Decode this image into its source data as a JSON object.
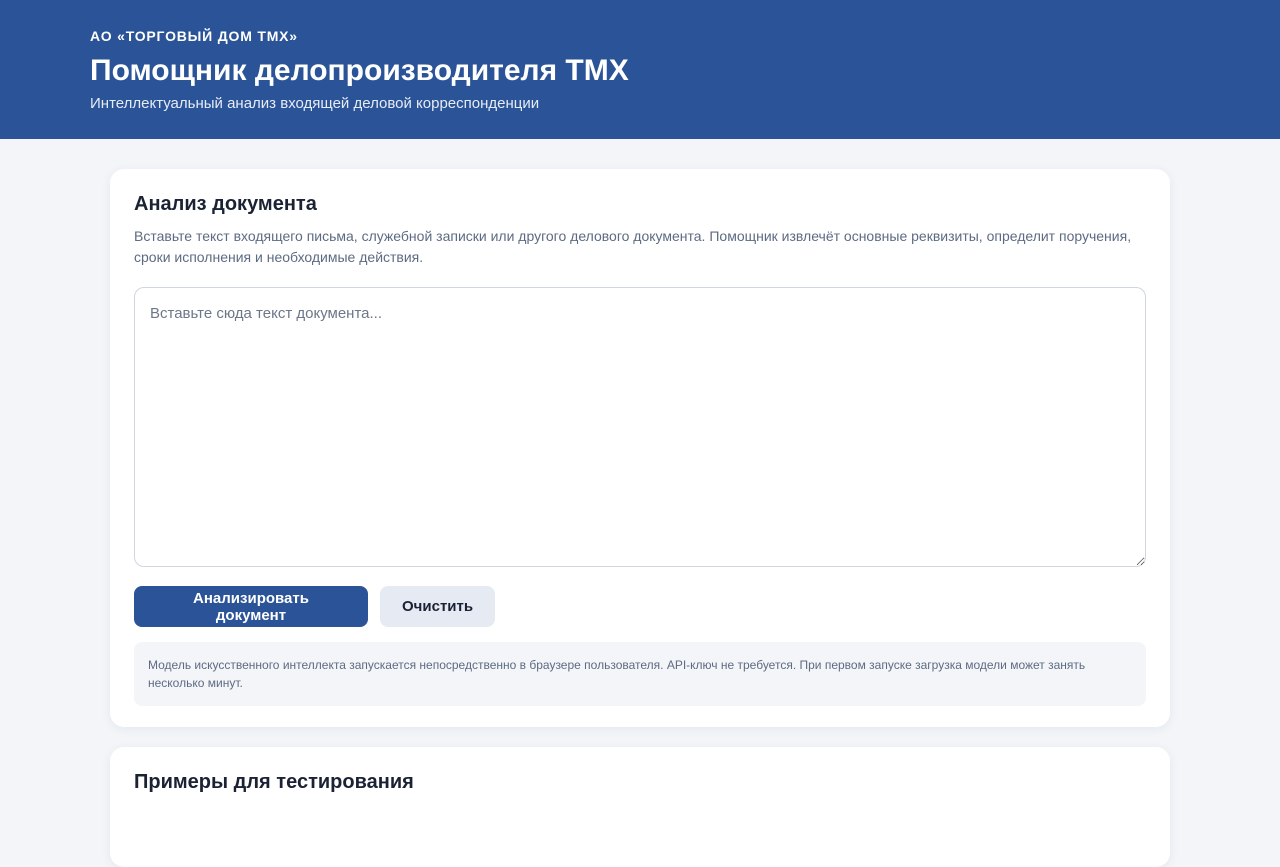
{
  "header": {
    "org": "АО «ТОРГОВЫЙ ДОМ ТМХ»",
    "title": "Помощник делопроизводителя ТМХ",
    "subtitle": "Интеллектуальный анализ входящей деловой корреспонденции"
  },
  "analyze": {
    "title": "Анализ документа",
    "description": "Вставьте текст входящего письма, служебной записки или другого делового документа. Помощник извлечёт основные реквизиты, определит поручения, сроки исполнения и необходимые действия.",
    "input": {
      "value": "",
      "placeholder": "Вставьте сюда текст документа..."
    },
    "analyze_button": "Анализировать документ",
    "clear_button": "Очистить",
    "note": "Модель искусственного интеллекта запускается непосредственно в браузере пользователя. API-ключ не требуется. При первом запуске загрузка модели может занять несколько минут."
  },
  "examples": {
    "title": "Примеры для тестирования"
  },
  "colors": {
    "header_bg": "#2b5397",
    "page_bg": "#f3f5f9",
    "primary_button": "#2b5397",
    "secondary_button": "#e6eaf2"
  }
}
